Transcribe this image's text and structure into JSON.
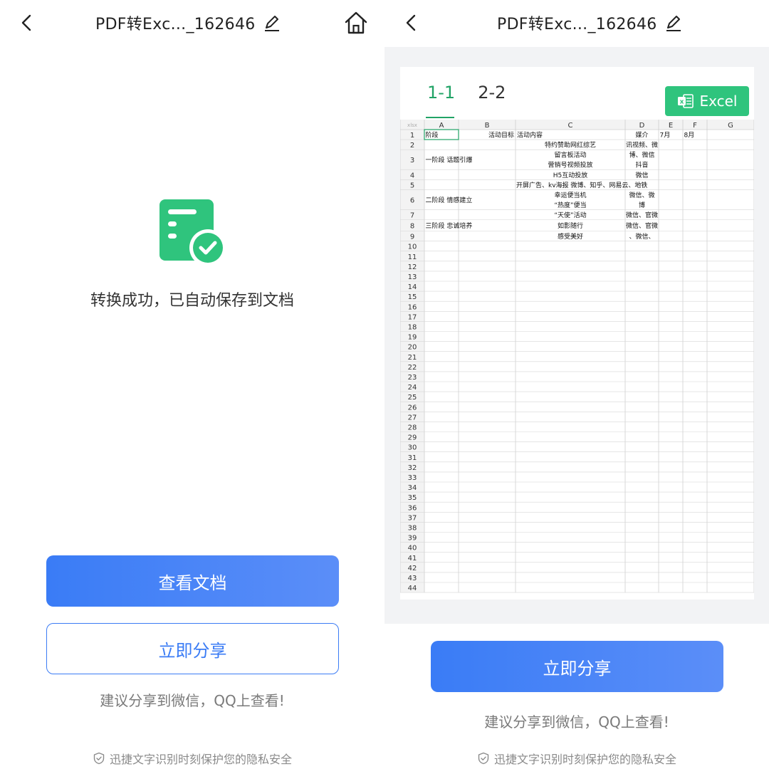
{
  "left": {
    "header": {
      "title": "PDF转Exc..._162646"
    },
    "success_message": "转换成功，已自动保存到文档",
    "view_button": "查看文档",
    "share_button": "立即分享",
    "share_hint": "建议分享到微信，QQ上查看!",
    "privacy_note": "迅捷文字识别时刻保护您的隐私安全"
  },
  "right": {
    "header": {
      "title": "PDF转Exc..._162646"
    },
    "preview": {
      "tabs": [
        {
          "label": "1-1",
          "active": true
        },
        {
          "label": "2-2",
          "active": false
        }
      ],
      "excel_button": "Excel",
      "excel_icon_letter": "x",
      "sheet": {
        "corner": "xlsx",
        "columns": [
          "A",
          "B",
          "C",
          "D",
          "E",
          "F",
          "G"
        ],
        "row_numbers": [
          "1",
          "2",
          "3",
          "4",
          "5",
          "6",
          "7",
          "8",
          "9",
          "10",
          "11",
          "12",
          "13",
          "14",
          "15",
          "16",
          "17",
          "18",
          "19",
          "20",
          "21",
          "22",
          "23",
          "24",
          "25",
          "26",
          "27",
          "28",
          "29",
          "30",
          "31",
          "32",
          "33",
          "34",
          "35",
          "36",
          "37",
          "38",
          "39",
          "40",
          "41",
          "42",
          "43",
          "44"
        ],
        "cells": [
          {
            "row": 1,
            "col": "A",
            "text": "阶段"
          },
          {
            "row": 1,
            "col": "B",
            "text": "活动目标"
          },
          {
            "row": 1,
            "col": "C",
            "text": "活动内容"
          },
          {
            "row": 1,
            "col": "D",
            "text": "媒介"
          },
          {
            "row": 1,
            "col": "E",
            "text": "7月"
          },
          {
            "row": 1,
            "col": "F",
            "text": "8月"
          },
          {
            "row": 2,
            "col": "C",
            "text": "特约赞助网红综艺"
          },
          {
            "row": 2,
            "col": "D",
            "text": "讯视频、微"
          },
          {
            "row": 3,
            "col": "C",
            "text": "留言板活动"
          },
          {
            "row": 3,
            "col": "C",
            "text": "营销号视频投放"
          },
          {
            "row": 3,
            "col": "A",
            "text": "一阶段 话题引爆"
          },
          {
            "row": 3,
            "col": "D",
            "text": "博、微信"
          },
          {
            "row": 3,
            "col": "D",
            "text": "抖音"
          },
          {
            "row": 4,
            "col": "C",
            "text": "H5互动投放"
          },
          {
            "row": 4,
            "col": "D",
            "text": "微信"
          },
          {
            "row": 5,
            "col": "C",
            "text": "开屏广告、kv海报 微博、知乎、网易云、地铁"
          },
          {
            "row": 6,
            "col": "C",
            "text": "幸运便当机"
          },
          {
            "row": 6,
            "col": "C",
            "text": "“热度”便当"
          },
          {
            "row": 6,
            "col": "A",
            "text": "二阶段 情感建立"
          },
          {
            "row": 6,
            "col": "D",
            "text": "微信、微"
          },
          {
            "row": 6,
            "col": "D",
            "text": "博"
          },
          {
            "row": 7,
            "col": "C",
            "text": "“天使”活动"
          },
          {
            "row": 7,
            "col": "D",
            "text": "微信、官微"
          },
          {
            "row": 8,
            "col": "A",
            "text": "三阶段 忠诚培养"
          },
          {
            "row": 8,
            "col": "C",
            "text": "如影随行"
          },
          {
            "row": 8,
            "col": "D",
            "text": "微信、官微"
          },
          {
            "row": 9,
            "col": "C",
            "text": "感受美好"
          },
          {
            "row": 9,
            "col": "D",
            "text": "、微信、"
          }
        ]
      }
    },
    "share_button": "立即分享",
    "share_hint": "建议分享到微信，QQ上查看!",
    "privacy_note": "迅捷文字识别时刻保护您的隐私安全"
  },
  "colors": {
    "primary": "#3b7cf5",
    "success_green": "#2fc47d",
    "tab_green": "#21a366"
  },
  "icons": [
    "back-icon",
    "pencil-icon",
    "home-icon",
    "document-check-icon",
    "shield-check-icon",
    "excel-icon"
  ]
}
